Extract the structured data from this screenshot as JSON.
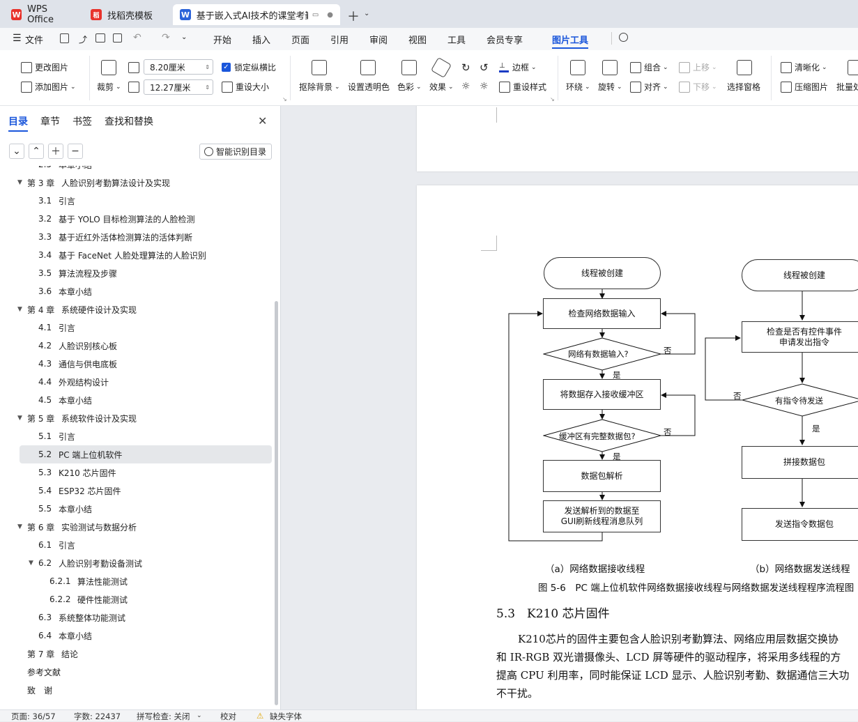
{
  "tabs": [
    {
      "label": "WPS Office",
      "logo": "W"
    },
    {
      "label": "找稻壳模板",
      "logo": "稻"
    },
    {
      "label": "基于嵌入式AI技术的课堂考勤i",
      "logo": "W"
    }
  ],
  "menu": {
    "file": "文件",
    "items": [
      "开始",
      "插入",
      "页面",
      "引用",
      "审阅",
      "视图",
      "工具",
      "会员专享",
      "图片工具"
    ]
  },
  "ribbon": {
    "change_image": "更改图片",
    "add_image": "添加图片",
    "crop": "裁剪",
    "width": "8.20厘米",
    "height": "12.27厘米",
    "lock_ratio": "锁定纵横比",
    "resize": "重设大小",
    "remove_bg": "抠除背景",
    "set_transparent": "设置透明色",
    "color": "色彩",
    "effect": "效果",
    "border": "边框",
    "reset_style": "重设样式",
    "wrap": "环绕",
    "rotate": "旋转",
    "group": "组合",
    "align": "对齐",
    "bring_forward": "上移",
    "send_backward": "下移",
    "selection_pane": "选择窗格",
    "clarify": "清晰化",
    "compress": "压缩图片",
    "batch": "批量处"
  },
  "sidebar": {
    "tabs": [
      "目录",
      "章节",
      "书签",
      "查找和替换"
    ],
    "smart_toc": "智能识别目录",
    "items": [
      {
        "num": "2.5",
        "text": "本章小结",
        "level": 2
      },
      {
        "num": "第 3 章",
        "text": "人脸识别考勤算法设计及实现",
        "level": 1
      },
      {
        "num": "3.1",
        "text": "引言",
        "level": 2
      },
      {
        "num": "3.2",
        "text": "基于 YOLO 目标检测算法的人脸检测",
        "level": 2
      },
      {
        "num": "3.3",
        "text": "基于近红外活体检测算法的活体判断",
        "level": 2
      },
      {
        "num": "3.4",
        "text": "基于 FaceNet 人脸处理算法的人脸识别",
        "level": 2
      },
      {
        "num": "3.5",
        "text": "算法流程及步骤",
        "level": 2
      },
      {
        "num": "3.6",
        "text": "本章小结",
        "level": 2
      },
      {
        "num": "第 4 章",
        "text": "系统硬件设计及实现",
        "level": 1
      },
      {
        "num": "4.1",
        "text": "引言",
        "level": 2
      },
      {
        "num": "4.2",
        "text": "人脸识别核心板",
        "level": 2
      },
      {
        "num": "4.3",
        "text": "通信与供电底板",
        "level": 2
      },
      {
        "num": "4.4",
        "text": "外观结构设计",
        "level": 2
      },
      {
        "num": "4.5",
        "text": "本章小结",
        "level": 2
      },
      {
        "num": "第 5 章",
        "text": "系统软件设计及实现",
        "level": 1
      },
      {
        "num": "5.1",
        "text": "引言",
        "level": 2
      },
      {
        "num": "5.2",
        "text": "PC 端上位机软件",
        "level": 2
      },
      {
        "num": "5.3",
        "text": "K210 芯片固件",
        "level": 2
      },
      {
        "num": "5.4",
        "text": "ESP32 芯片固件",
        "level": 2
      },
      {
        "num": "5.5",
        "text": "本章小结",
        "level": 2
      },
      {
        "num": "第 6 章",
        "text": "实验测试与数据分析",
        "level": 1
      },
      {
        "num": "6.1",
        "text": "引言",
        "level": 2
      },
      {
        "num": "6.2",
        "text": "人脸识别考勤设备测试",
        "level": 2
      },
      {
        "num": "6.2.1",
        "text": "算法性能测试",
        "level": 3
      },
      {
        "num": "6.2.2",
        "text": "硬件性能测试",
        "level": 3
      },
      {
        "num": "6.3",
        "text": "系统整体功能测试",
        "level": 2
      },
      {
        "num": "6.4",
        "text": "本章小结",
        "level": 2
      },
      {
        "num": "第 7 章",
        "text": "结论",
        "level": 1
      },
      {
        "num": "参考文献",
        "text": "",
        "level": 1
      },
      {
        "num": "致　谢",
        "text": "",
        "level": 1
      }
    ]
  },
  "flowchart": {
    "a_start": "线程被创建",
    "a_check": "检查网络数据输入",
    "a_dec1": "网络有数据输入?",
    "a_store": "将数据存入接收缓冲区",
    "a_dec2": "缓冲区有完整数据包?",
    "a_parse": "数据包解析",
    "a_send1": "发送解析到的数据至",
    "a_send2": "GUI刷新线程消息队列",
    "yes": "是",
    "no": "否",
    "b_start": "线程被创建",
    "b_check1": "检查是否有控件事件",
    "b_check2": "申请发出指令",
    "b_dec": "有指令待发送",
    "b_pack": "拼接数据包",
    "b_send": "发送指令数据包",
    "cap_a": "（a）网络数据接收线程",
    "cap_b": "（b）网络数据发送线程",
    "fig_caption": "图 5-6　PC 端上位机软件网络数据接收线程与网络数据发送线程程序流程图"
  },
  "doc": {
    "heading": "5.3　K210 芯片固件",
    "lines": [
      "K210芯片的固件主要包含人脸识别考勤算法、网络应用层数据交换协",
      "和 IR-RGB 双光谱摄像头、LCD 屏等硬件的驱动程序，将采用多线程的方",
      "提高 CPU 利用率，同时能保证 LCD 显示、人脸识别考勤、数据通信三大功",
      "不干扰。"
    ]
  },
  "status": {
    "page": "页面: 36/57",
    "words": "字数: 22437",
    "spell": "拼写检查: 关闭",
    "proof": "校对",
    "font": "缺失字体"
  }
}
